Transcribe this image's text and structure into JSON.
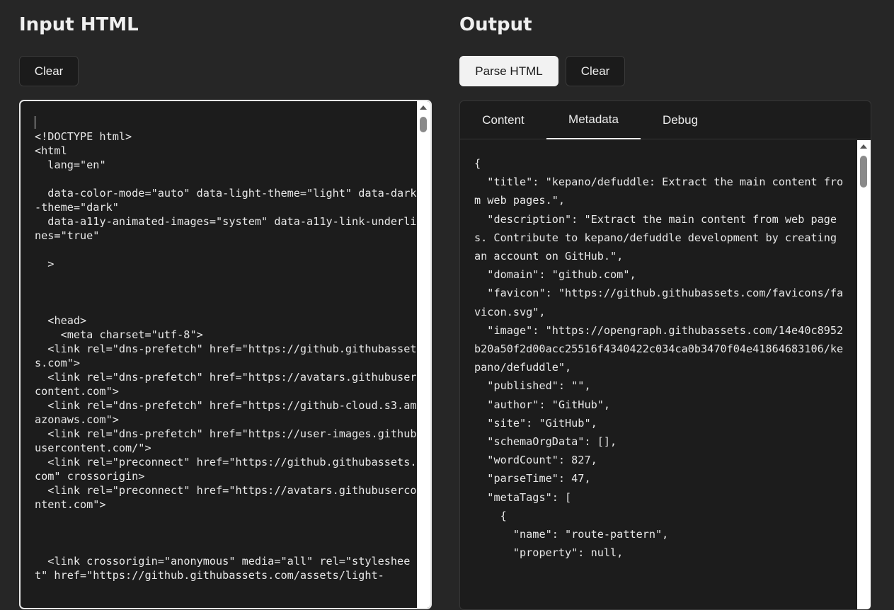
{
  "input": {
    "title": "Input HTML",
    "clear_label": "Clear",
    "code": "<!DOCTYPE html>\n<html\n  lang=\"en\"\n\n  data-color-mode=\"auto\" data-light-theme=\"light\" data-dark-theme=\"dark\"\n  data-a11y-animated-images=\"system\" data-a11y-link-underlines=\"true\"\n\n  >\n\n\n\n  <head>\n    <meta charset=\"utf-8\">\n  <link rel=\"dns-prefetch\" href=\"https://github.githubassets.com\">\n  <link rel=\"dns-prefetch\" href=\"https://avatars.githubusercontent.com\">\n  <link rel=\"dns-prefetch\" href=\"https://github-cloud.s3.amazonaws.com\">\n  <link rel=\"dns-prefetch\" href=\"https://user-images.githubusercontent.com/\">\n  <link rel=\"preconnect\" href=\"https://github.githubassets.com\" crossorigin>\n  <link rel=\"preconnect\" href=\"https://avatars.githubusercontent.com\">\n\n\n\n  <link crossorigin=\"anonymous\" media=\"all\" rel=\"stylesheet\" href=\"https://github.githubassets.com/assets/light-"
  },
  "output": {
    "title": "Output",
    "parse_label": "Parse HTML",
    "clear_label": "Clear",
    "tabs": [
      "Content",
      "Metadata",
      "Debug"
    ],
    "active_tab": "Metadata",
    "json_text": "{\n  \"title\": \"kepano/defuddle: Extract the main content from web pages.\",\n  \"description\": \"Extract the main content from web pages. Contribute to kepano/defuddle development by creating an account on GitHub.\",\n  \"domain\": \"github.com\",\n  \"favicon\": \"https://github.githubassets.com/favicons/favicon.svg\",\n  \"image\": \"https://opengraph.githubassets.com/14e40c8952b20a50f2d00acc25516f4340422c034ca0b3470f04e41864683106/kepano/defuddle\",\n  \"published\": \"\",\n  \"author\": \"GitHub\",\n  \"site\": \"GitHub\",\n  \"schemaOrgData\": [],\n  \"wordCount\": 827,\n  \"parseTime\": 47,\n  \"metaTags\": [\n    {\n      \"name\": \"route-pattern\",\n      \"property\": null,"
  }
}
